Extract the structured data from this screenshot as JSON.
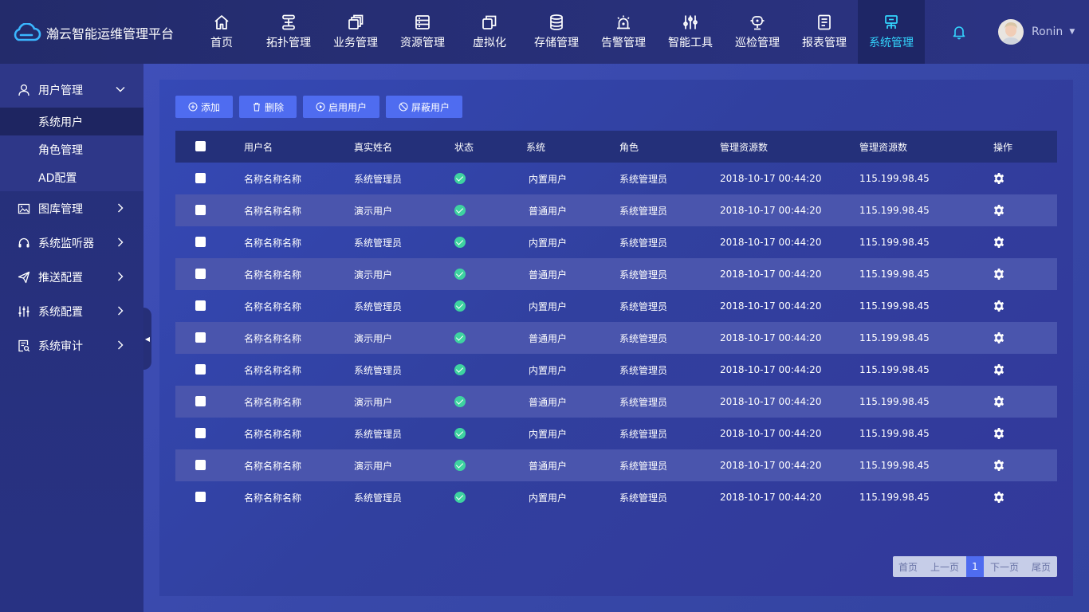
{
  "brand": {
    "title": "瀚云智能运维管理平台"
  },
  "nav": [
    {
      "label": "首页",
      "icon": "home-icon"
    },
    {
      "label": "拓扑管理",
      "icon": "topology-icon"
    },
    {
      "label": "业务管理",
      "icon": "business-icon"
    },
    {
      "label": "资源管理",
      "icon": "resource-icon"
    },
    {
      "label": "虚拟化",
      "icon": "virtualization-icon"
    },
    {
      "label": "存储管理",
      "icon": "database-icon"
    },
    {
      "label": "告警管理",
      "icon": "alarm-icon"
    },
    {
      "label": "智能工具",
      "icon": "tools-icon"
    },
    {
      "label": "巡检管理",
      "icon": "inspection-icon"
    },
    {
      "label": "报表管理",
      "icon": "report-icon"
    },
    {
      "label": "系统管理",
      "icon": "system-icon",
      "active": true
    }
  ],
  "user": {
    "name": "Ronin"
  },
  "sidebar": {
    "groups": [
      {
        "label": "用户管理",
        "icon": "user-icon",
        "expanded": true,
        "children": [
          {
            "label": "系统用户",
            "active": true
          },
          {
            "label": "角色管理"
          },
          {
            "label": "AD配置"
          }
        ]
      },
      {
        "label": "图库管理",
        "icon": "image-icon"
      },
      {
        "label": "系统监听器",
        "icon": "headset-icon"
      },
      {
        "label": "推送配置",
        "icon": "send-icon"
      },
      {
        "label": "系统配置",
        "icon": "sliders-icon"
      },
      {
        "label": "系统审计",
        "icon": "audit-icon"
      }
    ]
  },
  "toolbar": {
    "add": "添加",
    "delete": "删除",
    "enable": "启用用户",
    "block": "屏蔽用户"
  },
  "table": {
    "headers": [
      "用户名",
      "真实姓名",
      "状态",
      "系统",
      "角色",
      "管理资源数",
      "管理资源数",
      "操作"
    ],
    "rows": [
      {
        "username": "名称名称名称",
        "realname": "系统管理员",
        "system": "内置用户",
        "role": "系统管理员",
        "time": "2018-10-17 00:44:20",
        "ip": "115.199.98.45"
      },
      {
        "username": "名称名称名称",
        "realname": "演示用户",
        "system": "普通用户",
        "role": "系统管理员",
        "time": "2018-10-17 00:44:20",
        "ip": "115.199.98.45"
      },
      {
        "username": "名称名称名称",
        "realname": "系统管理员",
        "system": "内置用户",
        "role": "系统管理员",
        "time": "2018-10-17 00:44:20",
        "ip": "115.199.98.45"
      },
      {
        "username": "名称名称名称",
        "realname": "演示用户",
        "system": "普通用户",
        "role": "系统管理员",
        "time": "2018-10-17 00:44:20",
        "ip": "115.199.98.45"
      },
      {
        "username": "名称名称名称",
        "realname": "系统管理员",
        "system": "内置用户",
        "role": "系统管理员",
        "time": "2018-10-17 00:44:20",
        "ip": "115.199.98.45"
      },
      {
        "username": "名称名称名称",
        "realname": "演示用户",
        "system": "普通用户",
        "role": "系统管理员",
        "time": "2018-10-17 00:44:20",
        "ip": "115.199.98.45"
      },
      {
        "username": "名称名称名称",
        "realname": "系统管理员",
        "system": "内置用户",
        "role": "系统管理员",
        "time": "2018-10-17 00:44:20",
        "ip": "115.199.98.45"
      },
      {
        "username": "名称名称名称",
        "realname": "演示用户",
        "system": "普通用户",
        "role": "系统管理员",
        "time": "2018-10-17 00:44:20",
        "ip": "115.199.98.45"
      },
      {
        "username": "名称名称名称",
        "realname": "系统管理员",
        "system": "内置用户",
        "role": "系统管理员",
        "time": "2018-10-17 00:44:20",
        "ip": "115.199.98.45"
      },
      {
        "username": "名称名称名称",
        "realname": "演示用户",
        "system": "普通用户",
        "role": "系统管理员",
        "time": "2018-10-17 00:44:20",
        "ip": "115.199.98.45"
      },
      {
        "username": "名称名称名称",
        "realname": "系统管理员",
        "system": "内置用户",
        "role": "系统管理员",
        "time": "2018-10-17 00:44:20",
        "ip": "115.199.98.45"
      }
    ]
  },
  "pager": {
    "first": "首页",
    "prev": "上一页",
    "current": "1",
    "next": "下一页",
    "last": "尾页"
  },
  "colors": {
    "accent": "#33d6ff",
    "button": "#4f6cf0",
    "status_ok": "#3ed3a0"
  }
}
